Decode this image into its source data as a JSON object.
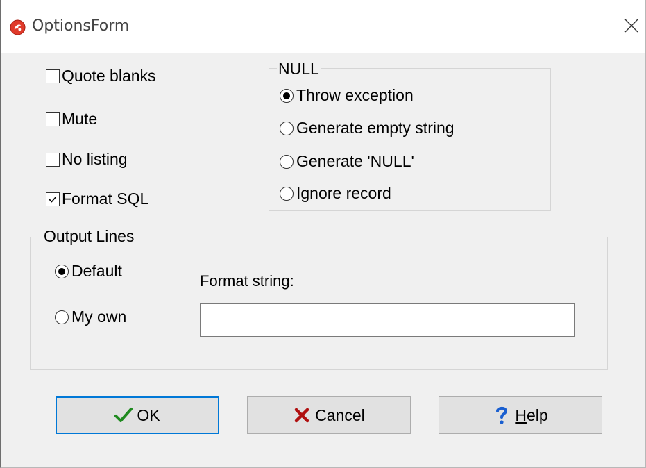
{
  "window": {
    "title": "OptionsForm",
    "app_icon": "app-logo-icon",
    "close_icon": "close-icon"
  },
  "options": {
    "quote_blanks": {
      "label": "Quote blanks",
      "checked": false
    },
    "mute": {
      "label": "Mute",
      "checked": false
    },
    "no_listing": {
      "label": "No listing",
      "checked": false
    },
    "format_sql": {
      "label": "Format SQL",
      "checked": true
    }
  },
  "null_group": {
    "title": "NULL",
    "options": [
      {
        "label": "Throw exception",
        "selected": true
      },
      {
        "label": "Generate empty string",
        "selected": false
      },
      {
        "label": "Generate 'NULL'",
        "selected": false
      },
      {
        "label": "Ignore record",
        "selected": false
      }
    ]
  },
  "output_lines": {
    "title": "Output Lines",
    "default_label": "Default",
    "default_selected": true,
    "my_own_label": "My own",
    "my_own_selected": false,
    "format_string_label": "Format string:",
    "format_string_value": ""
  },
  "buttons": {
    "ok": {
      "label": "OK",
      "icon": "checkmark-icon",
      "color": "#1f8a1f"
    },
    "cancel": {
      "label": "Cancel",
      "icon": "x-icon",
      "color": "#b01010"
    },
    "help": {
      "label": "Help",
      "icon": "question-icon",
      "color": "#1a5fd0"
    }
  },
  "colors": {
    "dialog_bg": "#f0f0f0",
    "title_bg": "#ffffff",
    "focus_border": "#0078d7",
    "button_bg": "#e1e1e1"
  }
}
